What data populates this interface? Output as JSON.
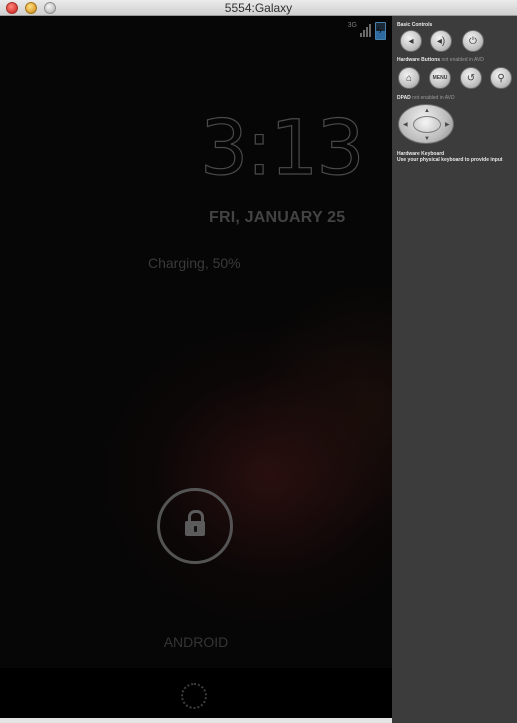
{
  "window": {
    "title": "5554:Galaxy"
  },
  "status_bar": {
    "network": "3G",
    "icons": [
      "signal-icon",
      "battery-charging-icon"
    ]
  },
  "lockscreen": {
    "time_hour": "3",
    "time_colon": ":",
    "time_minutes": "13",
    "date": "FRI, JANUARY 25",
    "charging_status": "Charging, 50%",
    "carrier": "ANDROID"
  },
  "controls_panel": {
    "basic_controls_label": "Basic Controls",
    "hardware_buttons_label": "Hardware Buttons",
    "hardware_buttons_note": "not enabled in AVD",
    "menu_button_label": "MENU",
    "dpad_label": "DPAD",
    "dpad_note": "not enabled in AVD",
    "keyboard_label": "Hardware Keyboard",
    "keyboard_hint": "Use your physical keyboard to provide input"
  },
  "icons": {
    "volume_down": "◂",
    "volume_up": "◂)",
    "power": "⏻",
    "home": "⌂",
    "back": "↺",
    "search": "⚲"
  },
  "colors": {
    "screen_bg": "#060606",
    "panel_bg": "#3c3c3c",
    "battery": "#2d6aa0"
  }
}
